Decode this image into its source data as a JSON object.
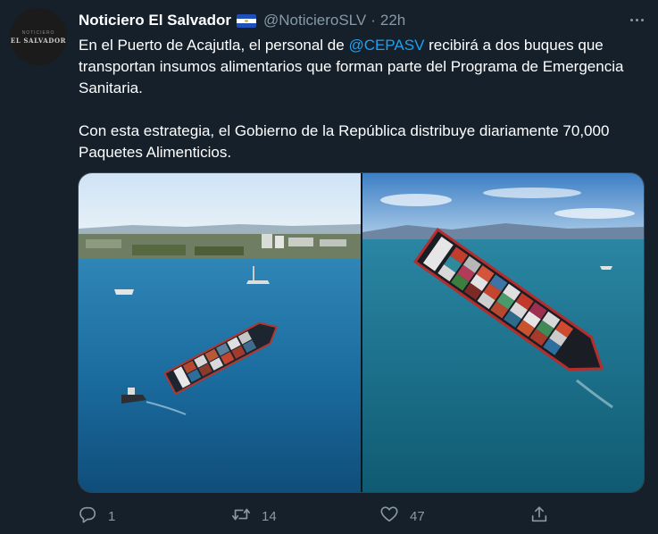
{
  "author": {
    "display_name": "Noticiero El Salvador",
    "handle": "@NoticieroSLV",
    "separator": "·",
    "time": "22h",
    "avatar_small_text": "NOTICIERO",
    "avatar_main_text": "EL SALVADOR"
  },
  "tweet": {
    "p1_before": "En el Puerto de Acajutla, el personal de ",
    "p1_mention": "@CEPASV",
    "p1_after": " recibirá a dos buques que transportan insumos alimentarios que forman parte del Programa de Emergencia Sanitaria.",
    "p2": "Con esta estrategia, el Gobierno de la República distribuye diariamente 70,000 Paquetes Alimenticios."
  },
  "actions": {
    "reply_count": "1",
    "retweet_count": "14",
    "like_count": "47"
  },
  "colors": {
    "background": "#15202b",
    "accent": "#1da1f2",
    "secondary_text": "#8899a6"
  },
  "icons": [
    "more-icon",
    "flag-icon",
    "reply-icon",
    "retweet-icon",
    "like-icon",
    "share-icon"
  ]
}
